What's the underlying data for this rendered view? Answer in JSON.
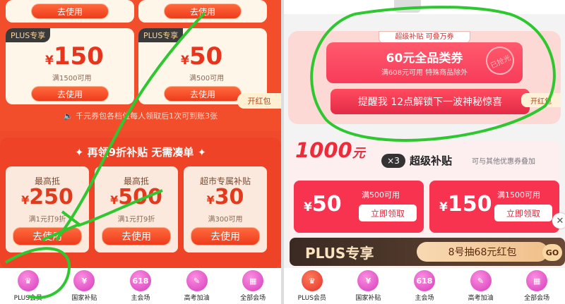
{
  "left": {
    "top_buttons": [
      "去使用",
      "去使用"
    ],
    "coupons": [
      {
        "tag": "PLUS专享",
        "symbol": "¥",
        "amount": "150",
        "condition": "满1500可用",
        "button": "去使用"
      },
      {
        "tag": "PLUS专享",
        "symbol": "¥",
        "amount": "50",
        "condition": "满500可用",
        "button": "去使用"
      }
    ],
    "side_badge": "开红包",
    "notice": "千元券包各档位每人领取后1次可到账3张",
    "section_title": "再领9折补贴 无需凑单",
    "subsidies": [
      {
        "label": "最高抵",
        "symbol": "¥",
        "amount": "250",
        "note": "满1元打9折",
        "button": "去使用"
      },
      {
        "label": "最高抵",
        "symbol": "¥",
        "amount": "500",
        "note": "满1元打9折",
        "button": "去使用"
      },
      {
        "label": "超市专属补贴",
        "symbol": "¥",
        "amount": "30",
        "note": "满300可用",
        "button": "去使用"
      }
    ]
  },
  "nav": [
    {
      "icon": "plus-crown-icon",
      "label": "PLUS会员"
    },
    {
      "icon": "subsidy-bag-icon",
      "label": "国家补贴"
    },
    {
      "icon": "618-badge-icon",
      "label": "主会场"
    },
    {
      "icon": "exam-icon",
      "label": "高考加油"
    },
    {
      "icon": "grid-icon",
      "label": "全部会场"
    }
  ],
  "nav_icon_text": {
    "618": "618"
  },
  "right": {
    "banner_tag": "超级补贴 可叠万券",
    "coupon_title": "60元全品类券",
    "coupon_sub": "满608元可用 特殊商品除外",
    "stamp": "已抢光",
    "remind_button": "提醒我 12点解锁下一波神秘惊喜",
    "side_badge": "开红包",
    "super": {
      "big": "1000",
      "yuan": "元",
      "times": "×3",
      "title": "超级补贴",
      "note": "可与其他优惠券叠加"
    },
    "cards": [
      {
        "symbol": "¥",
        "amount": "50",
        "condition": "满500可用",
        "button": "立即领取"
      },
      {
        "symbol": "¥",
        "amount": "150",
        "condition": "满1500可用",
        "button": "立即领取"
      }
    ],
    "plus_label": "PLUS专享",
    "plus_promo": "8号抽68元红包",
    "go": "GO"
  }
}
